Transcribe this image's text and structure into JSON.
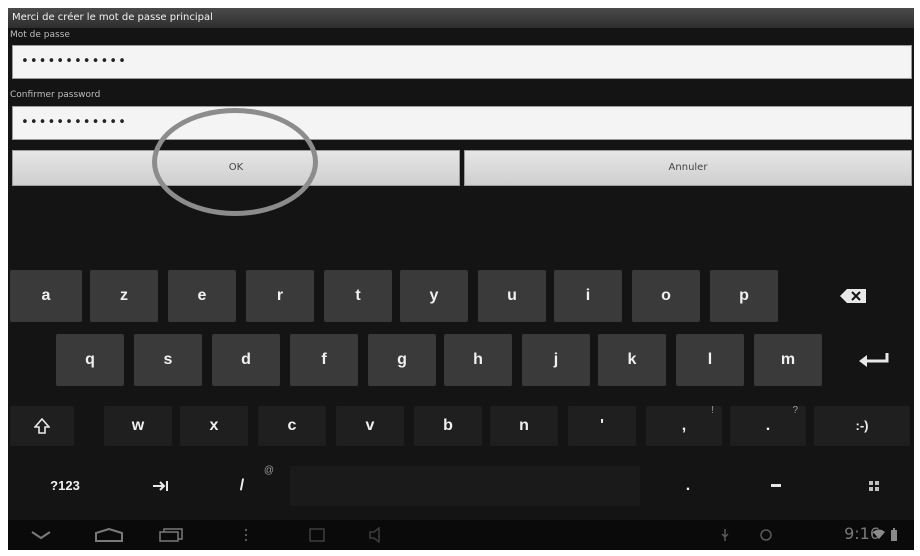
{
  "dialog": {
    "title": "Merci de créer le mot de passe principal",
    "password_label": "Mot de passe",
    "password_value": "••••••••••••",
    "confirm_label": "Confirmer password",
    "confirm_value": "••••••••••••",
    "ok_label": "OK",
    "cancel_label": "Annuler"
  },
  "keyboard": {
    "row1": [
      "a",
      "z",
      "e",
      "r",
      "t",
      "y",
      "u",
      "i",
      "o",
      "p"
    ],
    "row2": [
      "q",
      "s",
      "d",
      "f",
      "g",
      "h",
      "j",
      "k",
      "l",
      "m"
    ],
    "row3": [
      "w",
      "x",
      "c",
      "v",
      "b",
      "n",
      "'",
      ",",
      "."
    ],
    "row3_hints": {
      "comma": "!",
      "period": "?"
    },
    "smiley": ":-)",
    "numbers_key": "?123",
    "slash": "/",
    "slash_hint": "@",
    "period_key": "."
  },
  "status": {
    "clock": "9:16"
  }
}
